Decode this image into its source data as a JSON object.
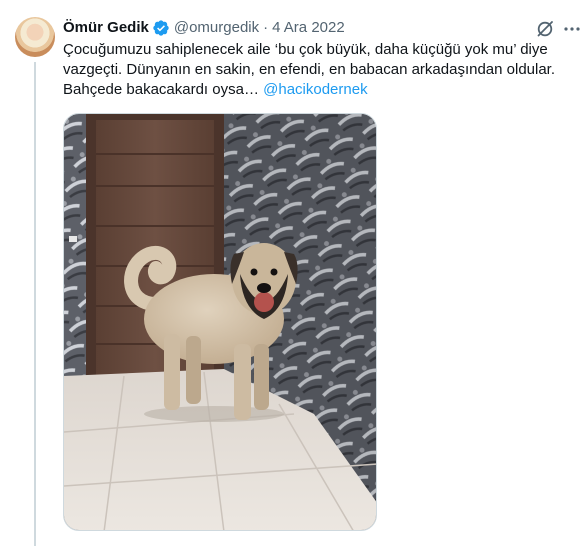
{
  "tweet": {
    "author_name": "Ömür Gedik",
    "handle": "@omurgedik",
    "separator": "·",
    "date": "4 Ara 2022",
    "text_line1": "Çocuğumuzu sahiplenecek aile ‘bu çok büyük, daha küçüğü yok mu’ diye",
    "text_line2": "vazgeçti.  Dünyanın en sakin, en efendi, en babacan arkadaşından oldular.",
    "text_line3": "Bahçede bakacakardı oysa…",
    "mention": "@hacikodernek"
  },
  "icons": {
    "verified": "verified-badge-icon",
    "grok": "grok-icon",
    "more": "more-options-icon"
  },
  "colors": {
    "accent": "#1d9bf0",
    "text": "#0f1419",
    "muted": "#536471",
    "line": "#cfd9de"
  }
}
